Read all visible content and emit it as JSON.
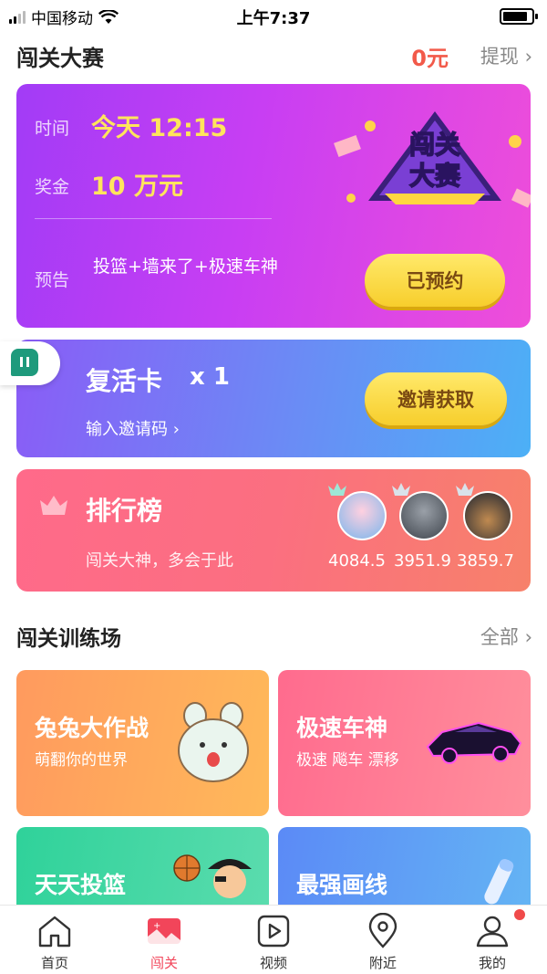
{
  "status_bar": {
    "carrier": "中国移动",
    "time": "上午7:37"
  },
  "header": {
    "title": "闯关大赛",
    "balance": "0元",
    "withdraw": "提现"
  },
  "contest": {
    "time_label": "时间",
    "time_value": "今天 12:15",
    "prize_label": "奖金",
    "prize_value": "10 万元",
    "preview_label": "预告",
    "preview_value": "投篮+墙来了+极速车神",
    "reserved_button": "已预约",
    "logo_text": [
      "闯关",
      "大赛"
    ]
  },
  "revive": {
    "title": "复活卡",
    "count": "x 1",
    "invite_code": "输入邀请码",
    "invite_button": "邀请获取"
  },
  "ranking": {
    "title": "排行榜",
    "subtitle": "闯关大神，多会于此",
    "scores": [
      "4084.5",
      "3951.9",
      "3859.7"
    ]
  },
  "training": {
    "title": "闯关训练场",
    "all_link": "全部"
  },
  "games": [
    {
      "name": "兔兔大作战",
      "desc": "萌翻你的世界"
    },
    {
      "name": "极速车神",
      "desc": "极速 飚车 漂移"
    },
    {
      "name": "天天投篮",
      "desc": ""
    },
    {
      "name": "最强画线",
      "desc": ""
    }
  ],
  "nav": [
    {
      "label": "首页",
      "icon": "home-icon"
    },
    {
      "label": "闯关",
      "icon": "game-icon"
    },
    {
      "label": "视频",
      "icon": "video-icon"
    },
    {
      "label": "附近",
      "icon": "location-icon"
    },
    {
      "label": "我的",
      "icon": "profile-icon"
    }
  ],
  "colors": {
    "accent_red": "#f2455a",
    "yellow": "#ffe55c",
    "balance_red": "#f25a4a"
  }
}
